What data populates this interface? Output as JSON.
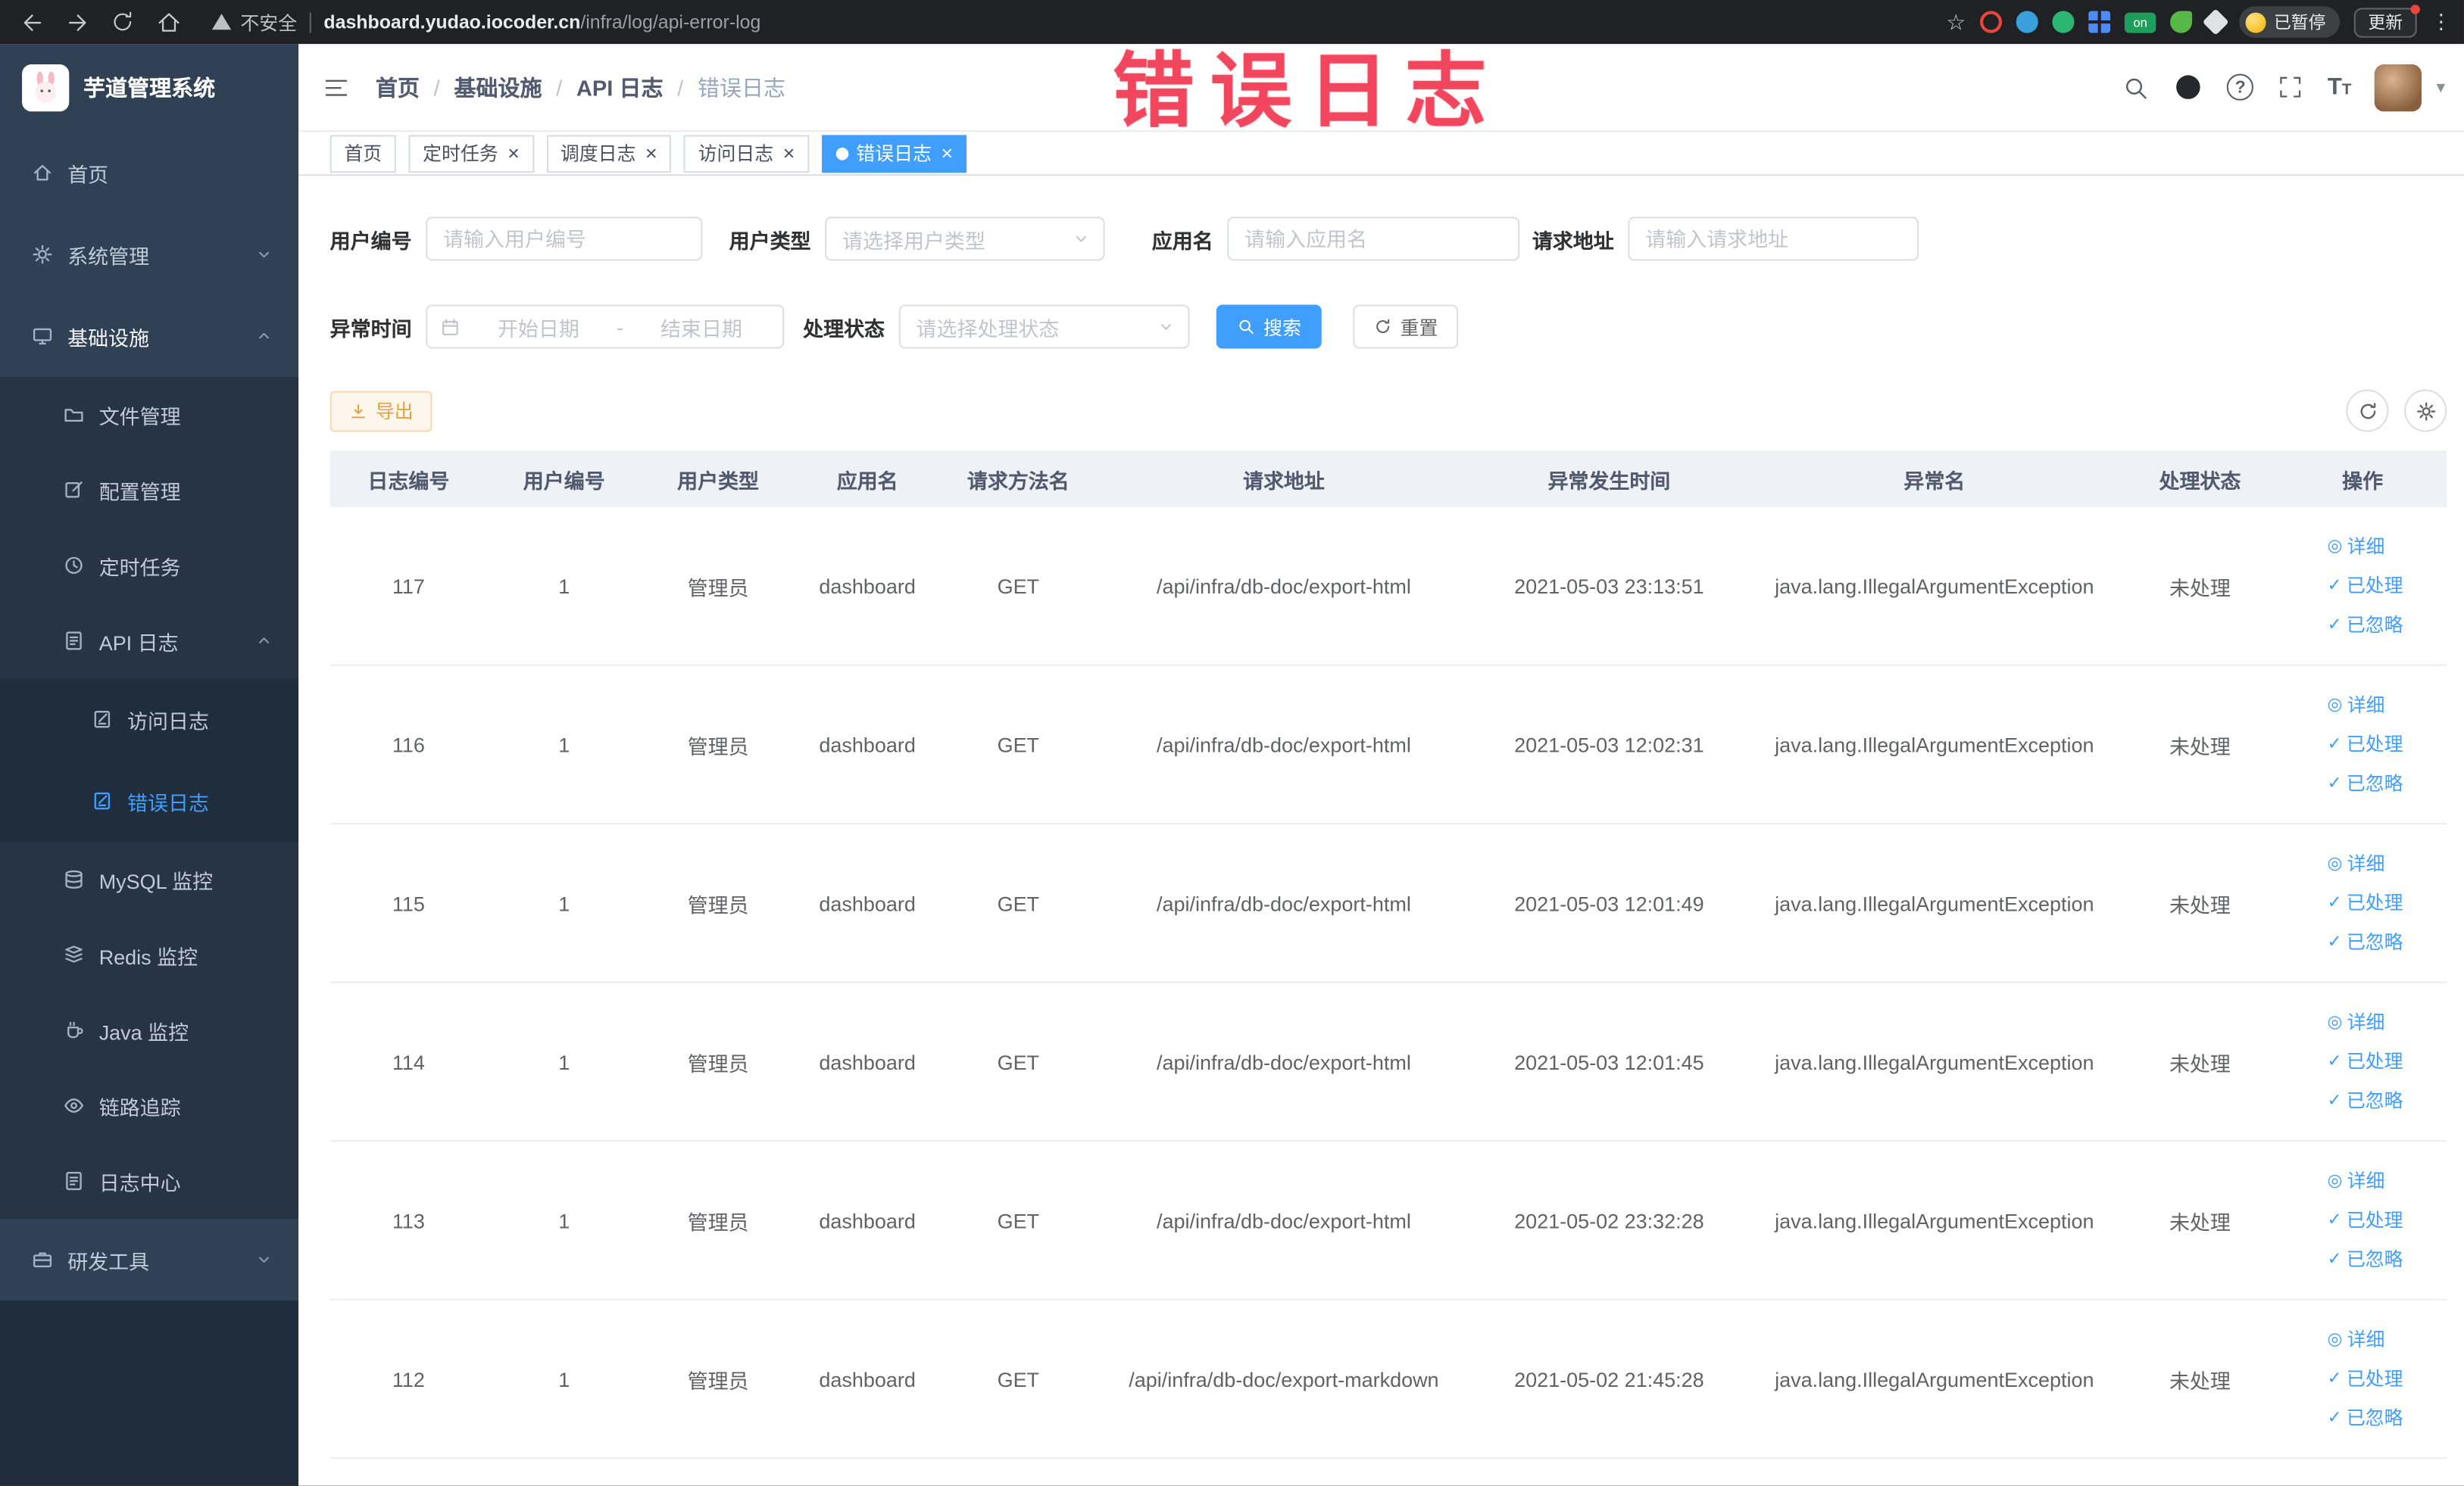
{
  "browser": {
    "security_warning": "不安全",
    "url_domain": "dashboard.yudao.iocoder.cn",
    "url_path": "/infra/log/api-error-log",
    "extension_badge": "on",
    "paused_badge": "已暂停",
    "update_button": "更新"
  },
  "annotation": {
    "text": "错误日志"
  },
  "glyphs": {
    "close": "×",
    "star": "☆",
    "kebab": "⋮",
    "question": "?",
    "font_T": "T",
    "caret": "▾",
    "detail_icon": "◎",
    "check_icon": "✓"
  },
  "sidebar": {
    "logo_title": "芋道管理系统",
    "items": [
      {
        "label": "首页"
      },
      {
        "label": "系统管理"
      },
      {
        "label": "基础设施"
      },
      {
        "label": "文件管理"
      },
      {
        "label": "配置管理"
      },
      {
        "label": "定时任务"
      },
      {
        "label": "API 日志"
      },
      {
        "label": "访问日志"
      },
      {
        "label": "错误日志"
      },
      {
        "label": "MySQL 监控"
      },
      {
        "label": "Redis 监控"
      },
      {
        "label": "Java 监控"
      },
      {
        "label": "链路追踪"
      },
      {
        "label": "日志中心"
      },
      {
        "label": "研发工具"
      }
    ]
  },
  "header": {
    "breadcrumb": [
      "首页",
      "基础设施",
      "API 日志",
      "错误日志"
    ],
    "separator": "/"
  },
  "tabs": [
    {
      "label": "首页",
      "closable": false,
      "active": false
    },
    {
      "label": "定时任务",
      "closable": true,
      "active": false
    },
    {
      "label": "调度日志",
      "closable": true,
      "active": false
    },
    {
      "label": "访问日志",
      "closable": true,
      "active": false
    },
    {
      "label": "错误日志",
      "closable": true,
      "active": true
    }
  ],
  "filters": {
    "user_id": {
      "label": "用户编号",
      "placeholder": "请输入用户编号"
    },
    "user_type": {
      "label": "用户类型",
      "placeholder": "请选择用户类型"
    },
    "app_name": {
      "label": "应用名",
      "placeholder": "请输入应用名"
    },
    "request_url": {
      "label": "请求地址",
      "placeholder": "请输入请求地址"
    },
    "exception_time": {
      "label": "异常时间",
      "start_placeholder": "开始日期",
      "separator": "-",
      "end_placeholder": "结束日期"
    },
    "process_status": {
      "label": "处理状态",
      "placeholder": "请选择处理状态"
    },
    "search_button": "搜索",
    "reset_button": "重置"
  },
  "toolbar": {
    "export_button": "导出"
  },
  "table": {
    "columns": [
      "日志编号",
      "用户编号",
      "用户类型",
      "应用名",
      "请求方法名",
      "请求地址",
      "异常发生时间",
      "异常名",
      "处理状态",
      "操作"
    ],
    "action_labels": {
      "detail": "详细",
      "processed": "已处理",
      "ignored": "已忽略"
    },
    "rows": [
      {
        "id": "117",
        "user_id": "1",
        "user_type": "管理员",
        "app": "dashboard",
        "method": "GET",
        "url": "/api/infra/db-doc/export-html",
        "time": "2021-05-03 23:13:51",
        "exception": "java.lang.IllegalArgumentException",
        "status": "未处理"
      },
      {
        "id": "116",
        "user_id": "1",
        "user_type": "管理员",
        "app": "dashboard",
        "method": "GET",
        "url": "/api/infra/db-doc/export-html",
        "time": "2021-05-03 12:02:31",
        "exception": "java.lang.IllegalArgumentException",
        "status": "未处理"
      },
      {
        "id": "115",
        "user_id": "1",
        "user_type": "管理员",
        "app": "dashboard",
        "method": "GET",
        "url": "/api/infra/db-doc/export-html",
        "time": "2021-05-03 12:01:49",
        "exception": "java.lang.IllegalArgumentException",
        "status": "未处理"
      },
      {
        "id": "114",
        "user_id": "1",
        "user_type": "管理员",
        "app": "dashboard",
        "method": "GET",
        "url": "/api/infra/db-doc/export-html",
        "time": "2021-05-03 12:01:45",
        "exception": "java.lang.IllegalArgumentException",
        "status": "未处理"
      },
      {
        "id": "113",
        "user_id": "1",
        "user_type": "管理员",
        "app": "dashboard",
        "method": "GET",
        "url": "/api/infra/db-doc/export-html",
        "time": "2021-05-02 23:32:28",
        "exception": "java.lang.IllegalArgumentException",
        "status": "未处理"
      },
      {
        "id": "112",
        "user_id": "1",
        "user_type": "管理员",
        "app": "dashboard",
        "method": "GET",
        "url": "/api/infra/db-doc/export-markdown",
        "time": "2021-05-02 21:45:28",
        "exception": "java.lang.IllegalArgumentException",
        "status": "未处理"
      }
    ]
  }
}
